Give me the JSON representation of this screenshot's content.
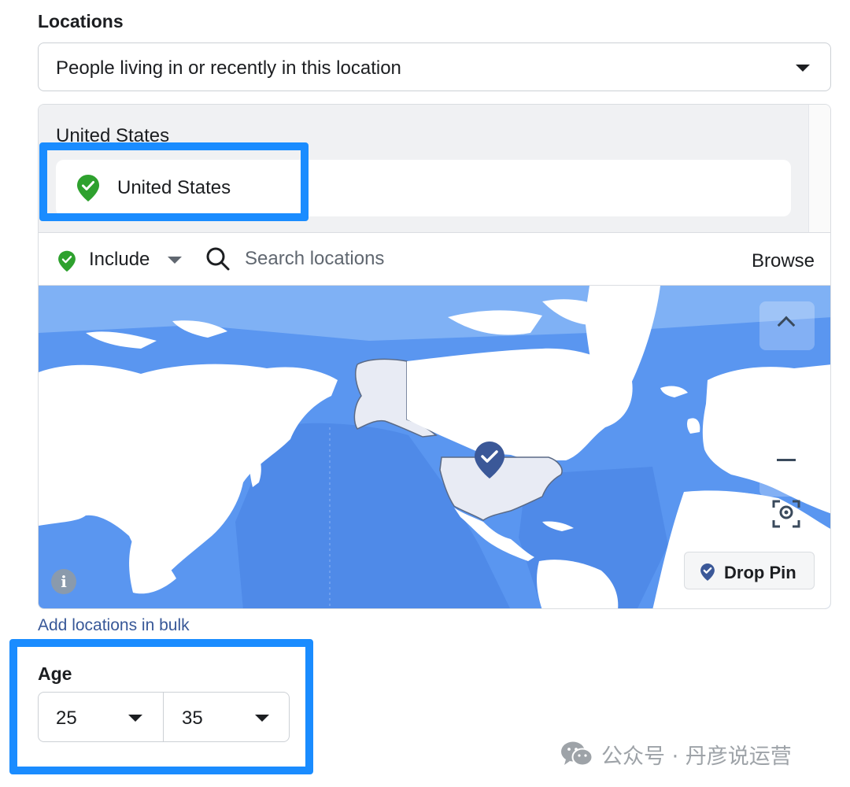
{
  "locations": {
    "title": "Locations",
    "mode_selected": "People living in or recently in this location",
    "group_label": "United States",
    "selected_chip": "United States",
    "toolbar": {
      "include_label": "Include",
      "search_placeholder": "Search locations",
      "browse_label": "Browse"
    },
    "map": {
      "drop_pin_label": "Drop Pin",
      "info_icon_glyph": "i",
      "pin_color": "#3b5898",
      "include_color": "#2ea12e"
    },
    "bulk_link": "Add locations in bulk"
  },
  "age": {
    "title": "Age",
    "min": "25",
    "max": "35"
  },
  "highlight_color": "#1a8cff",
  "watermark": "公众号 · 丹彦说运营"
}
